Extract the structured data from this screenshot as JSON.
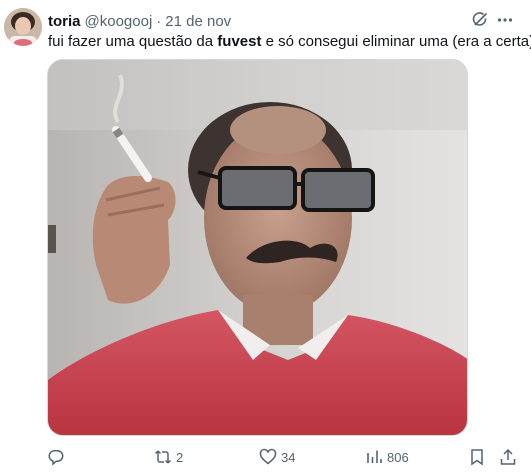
{
  "tweet": {
    "author_name": "toria",
    "handle": "@koogooj",
    "separator": "·",
    "time": "21 de nov",
    "text_before": "fui fazer uma questão da ",
    "text_bold": "fuvest",
    "text_after": " e só consegui eliminar uma (era a certa)",
    "media_description_icon": "photo"
  },
  "actions": {
    "reply_count": "",
    "retweet_count": "2",
    "like_count": "34",
    "views_count": "806"
  },
  "icons": {
    "grok": "grok-icon",
    "more": "more-icon",
    "reply": "reply-icon",
    "retweet": "retweet-icon",
    "like": "heart-icon",
    "views": "views-icon",
    "bookmark": "bookmark-icon",
    "share": "share-icon"
  },
  "colors": {
    "text": "#0f1419",
    "secondary": "#536471",
    "border": "#cfd9de"
  }
}
